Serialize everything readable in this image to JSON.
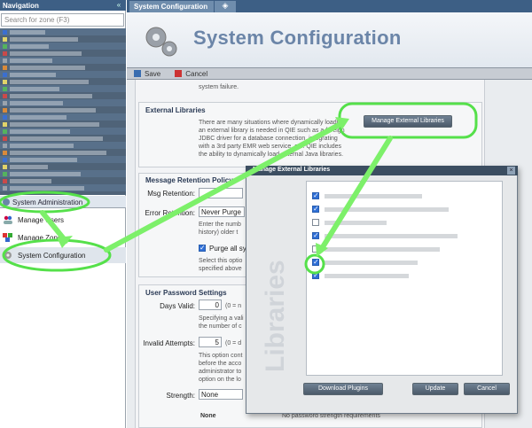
{
  "nav": {
    "title": "Navigation",
    "search_placeholder": "Search for zone (F3)",
    "group_label": "System Administration",
    "items": [
      {
        "label": "Manage Users",
        "icon": "users-icon"
      },
      {
        "label": "Manage Zones",
        "icon": "zones-icon"
      },
      {
        "label": "System Configuration",
        "icon": "gear-icon"
      }
    ]
  },
  "tabs": {
    "active": "System Configuration",
    "pin_glyph": "◈"
  },
  "page": {
    "title": "System Configuration",
    "toolbar": {
      "save": "Save",
      "cancel": "Cancel"
    },
    "cutoff_text": "system failure.",
    "external_libraries": {
      "header": "External Libraries",
      "lines": [
        "There are many situations where dynamically loading",
        "an external library is needed in QIE such as a foreign",
        "JDBC driver for a database connection, integrating",
        "with a 3rd party EMR web service, etc. QIE includes",
        "the ability to dynamically load external Java libraries."
      ],
      "button": "Manage External Libraries"
    },
    "message_retention": {
      "header": "Message Retention Policy",
      "msg_retention_label": "Msg Retention:",
      "error_retention_label": "Error Retention:",
      "error_retention_value": "Never Purge",
      "enter_lines": [
        "Enter the numb",
        "history) older t"
      ],
      "purge_label": "Purge all sy",
      "select_lines": [
        "Select this optio",
        "specified above"
      ]
    },
    "user_password": {
      "header": "User Password Settings",
      "days_valid_label": "Days Valid:",
      "days_valid_value": "0",
      "days_valid_hint": "(0 = n",
      "days_lines": [
        "Specifying a vali",
        "the number of c"
      ],
      "invalid_attempts_label": "Invalid Attempts:",
      "invalid_attempts_value": "5",
      "invalid_hint": "(0 = d",
      "invalid_lines": [
        "This option cont",
        "before the acco",
        "administrator to",
        "option on the lo"
      ],
      "strength_label": "Strength:",
      "strength_value": "None",
      "strength_bottom_value": "None",
      "strength_bottom_text": "No password strength requirements"
    }
  },
  "dialog": {
    "title": "Manage External Libraries",
    "watermark": "Libraries",
    "rows": [
      {
        "checked": true,
        "w": 110
      },
      {
        "checked": true,
        "w": 140
      },
      {
        "checked": false,
        "w": 70
      },
      {
        "checked": true,
        "w": 150
      },
      {
        "checked": false,
        "w": 130
      },
      {
        "checked": true,
        "w": 105
      },
      {
        "checked": true,
        "w": 95
      }
    ],
    "buttons": {
      "download": "Download Plugins",
      "update": "Update",
      "cancel": "Cancel"
    }
  },
  "colors": {
    "accent": "#3d5f85",
    "highlight": "#54e34a"
  }
}
